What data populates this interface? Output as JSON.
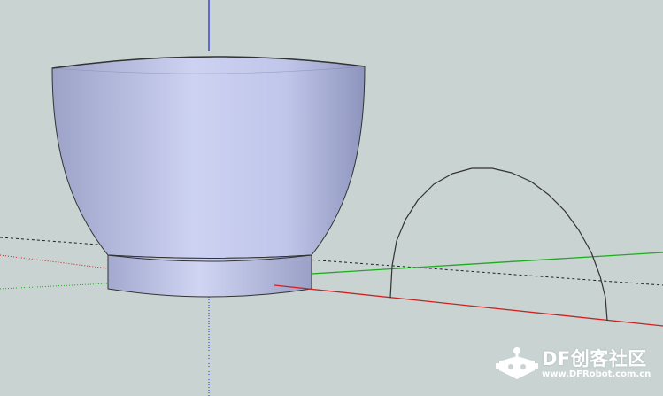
{
  "scene": {
    "background": "#c8d3d2",
    "axis_colors": {
      "red": "#cc2222",
      "green": "#1faa1f",
      "blue": "#2233cc"
    },
    "bowl_fill": "#c3c9ec",
    "edge_color": "#333333"
  },
  "watermark": {
    "brand": "DF创客社区",
    "url": "www.DFRobot.com.cn",
    "icon": "dfrobot-robot-icon"
  }
}
